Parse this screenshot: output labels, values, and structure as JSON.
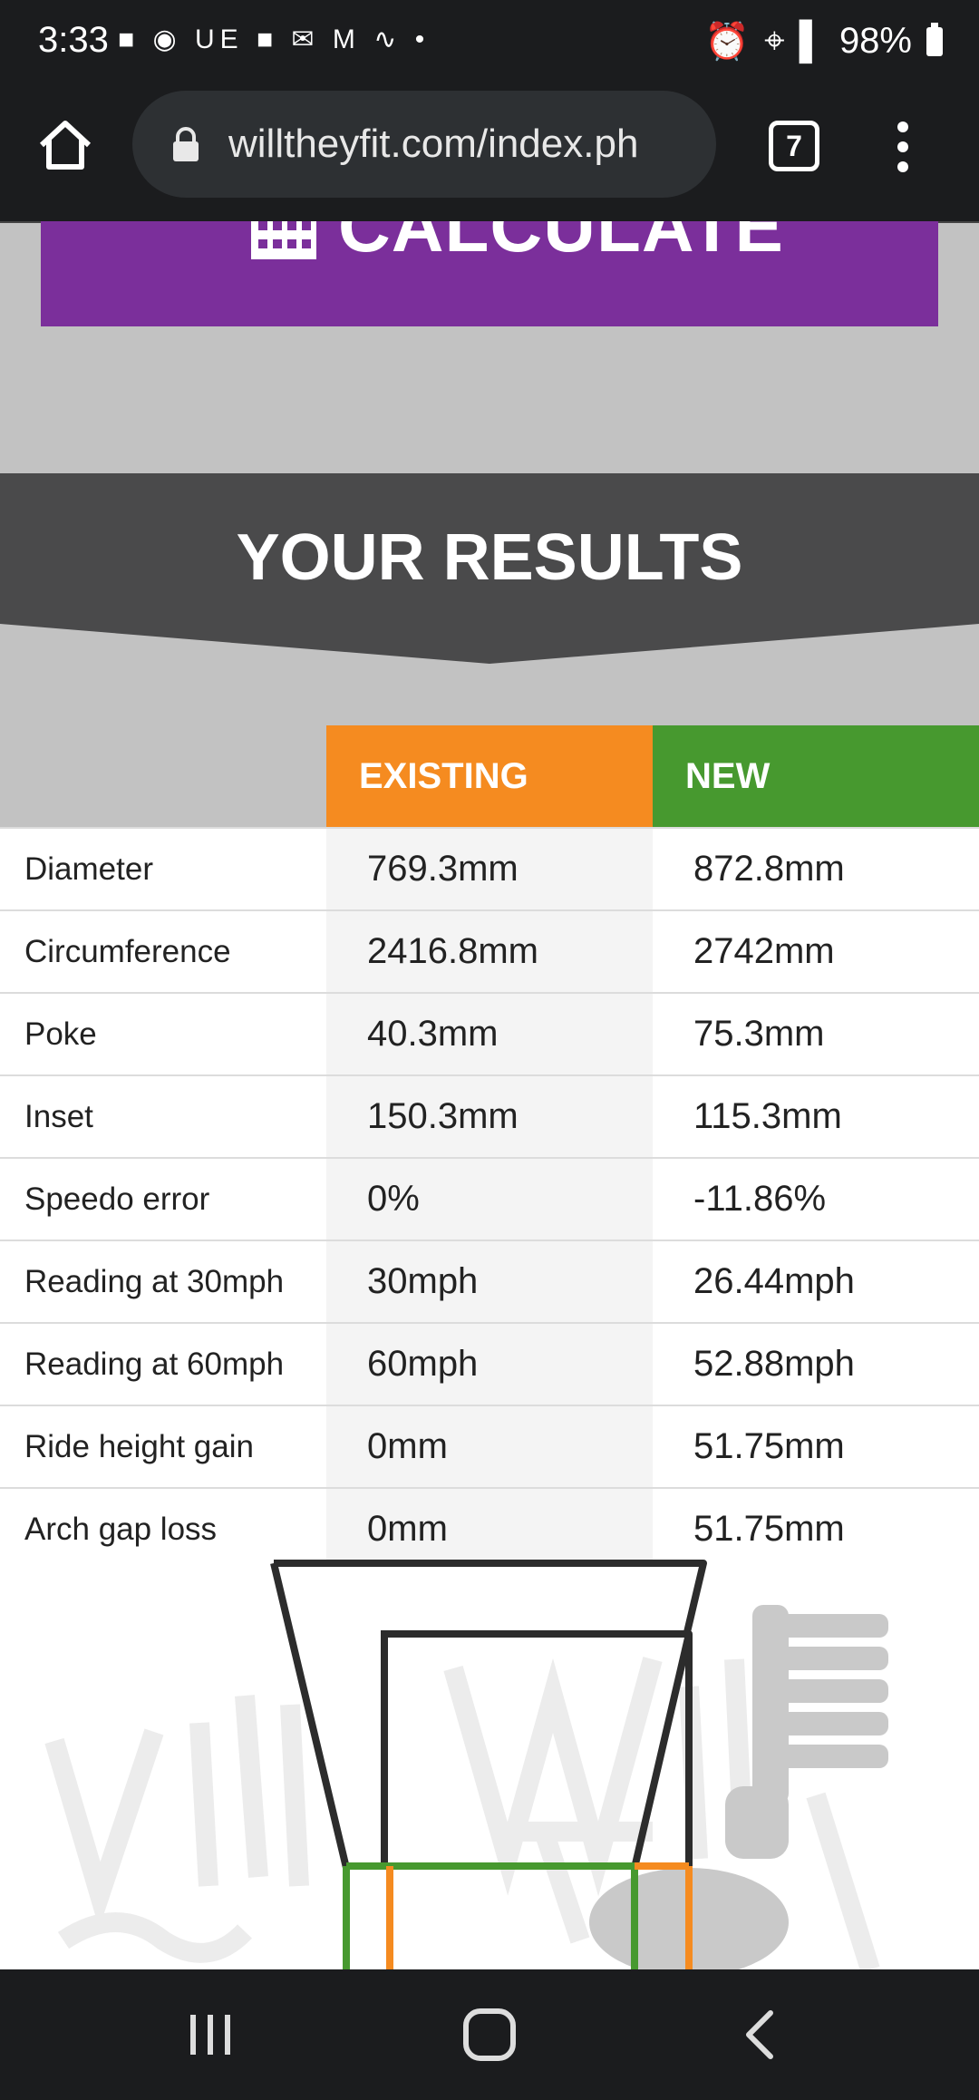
{
  "status_bar": {
    "time": "3:33",
    "battery": "98%"
  },
  "browser": {
    "url": "willtheyfit.com/index.ph",
    "tab_count": "7"
  },
  "page": {
    "calculate_label": "CALCULATE",
    "results_title": "YOUR RESULTS",
    "columns": {
      "existing": "EXISTING",
      "new": "NEW"
    },
    "rows": [
      {
        "label": "Diameter",
        "existing": "769.3mm",
        "new": "872.8mm"
      },
      {
        "label": "Circumference",
        "existing": "2416.8mm",
        "new": "2742mm"
      },
      {
        "label": "Poke",
        "existing": "40.3mm",
        "new": "75.3mm"
      },
      {
        "label": "Inset",
        "existing": "150.3mm",
        "new": "115.3mm"
      },
      {
        "label": "Speedo error",
        "existing": "0%",
        "new": "-11.86%"
      },
      {
        "label": "Reading at 30mph",
        "existing": "30mph",
        "new": "26.44mph"
      },
      {
        "label": "Reading at 60mph",
        "existing": "60mph",
        "new": "52.88mph"
      },
      {
        "label": "Ride height gain",
        "existing": "0mm",
        "new": "51.75mm"
      },
      {
        "label": "Arch gap loss",
        "existing": "0mm",
        "new": "51.75mm"
      }
    ]
  },
  "colors": {
    "calculate_bg": "#7b2f9b",
    "existing": "#f58b20",
    "new": "#47992f",
    "results_banner": "#4a4a4b"
  },
  "icons": [
    "home-icon",
    "lock-icon",
    "more-vert-icon",
    "calculator-icon",
    "recents-icon",
    "home-nav-icon",
    "back-icon"
  ]
}
